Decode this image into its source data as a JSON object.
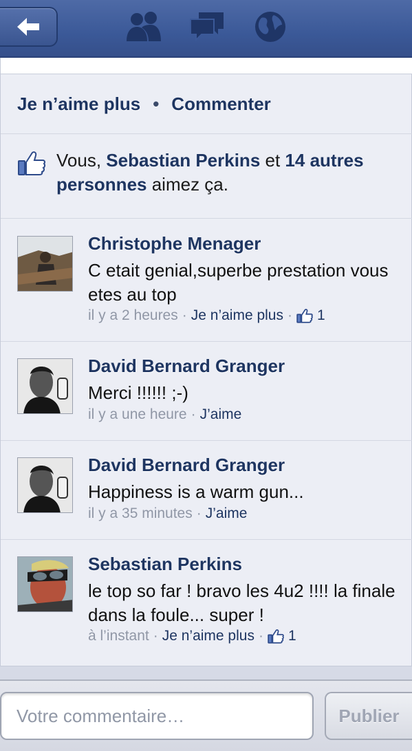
{
  "header": {
    "back_icon": "arrow-left-icon",
    "nav_icons": [
      "friends-icon",
      "messages-icon",
      "globe-icon"
    ]
  },
  "post_actions": {
    "unlike_label": "Je n’aime plus",
    "separator": "•",
    "comment_label": "Commenter"
  },
  "likes": {
    "prefix": "Vous, ",
    "person": "Sebastian Perkins",
    "middle": " et ",
    "others": "14 autres personnes",
    "suffix": " aimez ça."
  },
  "comments": [
    {
      "author": "Christophe Menager",
      "text": "C etait genial,superbe prestation vous etes au top",
      "time": "il y a 2 heures",
      "action": "Je n’aime plus",
      "like_count": "1",
      "avatar": "photo"
    },
    {
      "author": "David Bernard Granger",
      "text": "Merci !!!!!! ;-)",
      "time": "il y a une heure",
      "action": "J’aime",
      "like_count": "",
      "avatar": "photo"
    },
    {
      "author": "David Bernard Granger",
      "text": "Happiness is a warm gun...",
      "time": "il y a 35 minutes",
      "action": "J’aime",
      "like_count": "",
      "avatar": "photo"
    },
    {
      "author": "Sebastian Perkins",
      "text": "le top so far ! bravo les 4u2 !!!! la finale dans la foule... super !",
      "time": "à l’instant",
      "action": "Je n’aime plus",
      "like_count": "1",
      "avatar": "photo"
    }
  ],
  "composer": {
    "placeholder": "Votre commentaire…",
    "publish_label": "Publier"
  },
  "meta_separator": "·",
  "colors": {
    "header_blue": "#3b5998",
    "link_blue": "#1e3561",
    "background": "#eceef5"
  }
}
